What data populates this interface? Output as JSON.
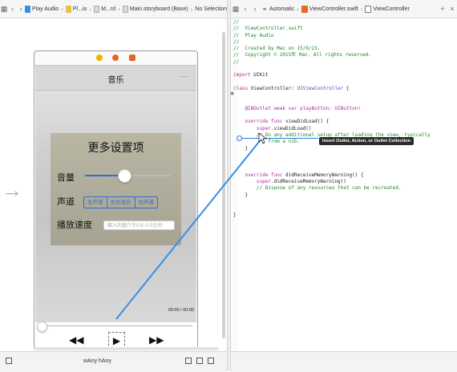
{
  "left_jumpbar": {
    "crumbs": [
      "Play Audio",
      "Pl...io",
      "M...rd",
      "Main.storyboard (Base)",
      "No Selection"
    ]
  },
  "right_jumpbar": {
    "crumbs": [
      "Automatic",
      "ViewController.swift",
      "ViewController"
    ]
  },
  "scene": {
    "nav_title": "音乐",
    "nav_item": "···",
    "panel_title": "更多设置项",
    "volume_label": "音量",
    "volume_level": 0.45,
    "channel_label": "声道",
    "channel_options": [
      "左声道",
      "左右混合",
      "右声道"
    ],
    "speed_label": "播放速度",
    "speed_placeholder": "输入的值介于0.5~2.0之间",
    "time_text": "00:00 / 00:00",
    "progress_value": 0.0,
    "rewind_glyph": "◀◀",
    "play_glyph": "▶",
    "forward_glyph": "▶▶"
  },
  "bottombar": {
    "size_class_width": "wAny",
    "size_class_height": "hAny"
  },
  "code": {
    "lines": [
      {
        "t": "//",
        "k": "com"
      },
      {
        "t": "//  ViewController.swift",
        "k": "com"
      },
      {
        "t": "//  Play Audio",
        "k": "com"
      },
      {
        "t": "//",
        "k": "com"
      },
      {
        "t": "//  Created by Mac on 15/9/23.",
        "k": "com"
      },
      {
        "t": "//  Copyright © 2015年 Mac. All rights reserved.",
        "k": "com"
      },
      {
        "t": "//",
        "k": "com"
      },
      {
        "t": "",
        "k": "plain"
      },
      {
        "t": "import UIKit",
        "k": "kw"
      },
      {
        "t": "",
        "k": "plain"
      },
      {
        "t": "class ViewController: UIViewController {",
        "k": "class"
      },
      {
        "t": "",
        "k": "plain"
      },
      {
        "t": "",
        "k": "plain"
      },
      {
        "t": "    @IBOutlet weak var playButton: UIButton!",
        "k": "outlet"
      },
      {
        "t": "",
        "k": "plain"
      },
      {
        "t": "    override func viewDidLoad() {",
        "k": "kw"
      },
      {
        "t": "        super.viewDidLoad()",
        "k": "kw"
      },
      {
        "t": "        // Do any additional setup after loading the view, typically",
        "k": "com"
      },
      {
        "t": "            from a nib.",
        "k": "com"
      },
      {
        "t": "    }",
        "k": "plain"
      },
      {
        "t": "",
        "k": "plain"
      },
      {
        "t": "",
        "k": "plain"
      },
      {
        "t": "",
        "k": "plain"
      },
      {
        "t": "    override func didReceiveMemoryWarning() {",
        "k": "kw"
      },
      {
        "t": "        super.didReceiveMemoryWarning()",
        "k": "kw"
      },
      {
        "t": "        // Dispose of any resources that can be recreated.",
        "k": "com"
      },
      {
        "t": "    }",
        "k": "plain"
      },
      {
        "t": "",
        "k": "plain"
      },
      {
        "t": "",
        "k": "plain"
      },
      {
        "t": "}",
        "k": "plain"
      }
    ],
    "tooltip": "Insert Outlet, Action, or Outlet Collection"
  },
  "colors": {
    "accent": "#2a6fd6",
    "comment": "#1e8a2e",
    "keyword": "#b1299e",
    "connection_line": "#3a8ee6"
  }
}
